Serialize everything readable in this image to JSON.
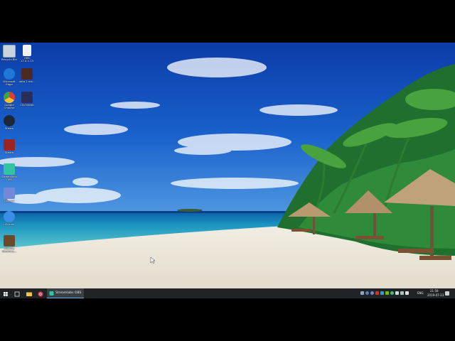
{
  "desktop": {
    "icons": [
      {
        "label": "Recycle Bin"
      },
      {
        "label": "OBS 17.0.1.13"
      },
      {
        "label": "Microsoft Edge"
      },
      {
        "label": "dota 2 ma..."
      },
      {
        "label": "Google Chrome"
      },
      {
        "label": "C5c5464b"
      },
      {
        "label": "Steam"
      },
      {
        "label": "Steam"
      },
      {
        "label": "Streamlabs OBS"
      },
      {
        "label": "Discord"
      },
      {
        "label": "uTorrent"
      },
      {
        "label": "Roomie Downloa..."
      }
    ]
  },
  "taskbar": {
    "active_app_label": "Streamlabs OBS",
    "language": "ENG",
    "time": "21:59",
    "date": "2019-07-23"
  },
  "colors": {
    "taskbar_bg": "#1f2326",
    "taskbar_active_bg": "#3a3f44",
    "taskbar_accent": "#6aa9e6"
  }
}
